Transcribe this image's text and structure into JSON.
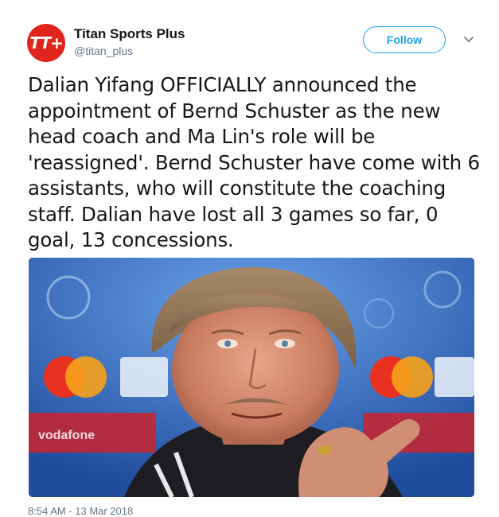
{
  "author": {
    "avatar_text": "TT+",
    "name": "Titan Sports Plus",
    "handle": "@titan_plus"
  },
  "follow_label": "Follow",
  "tweet": {
    "text": "Dalian Yifang OFFICIALLY announced the appointment of Bernd Schuster as the new head coach and Ma Lin's role will be 'reassigned'. Bernd Schuster have come with 6 assistants, who will constitute the coaching staff. Dalian have lost all 3 games so far, 0 goal, 13 concessions."
  },
  "photo": {
    "sponsor_text_1": "MasterCard",
    "sponsor_text_2": "vodafone"
  },
  "timestamp": "8:54 AM - 13 Mar 2018",
  "colors": {
    "accent": "#1da1f2",
    "brand": "#e0261c",
    "text": "#14171a",
    "muted": "#657786"
  },
  "icons": [
    "chevron-down-icon"
  ]
}
